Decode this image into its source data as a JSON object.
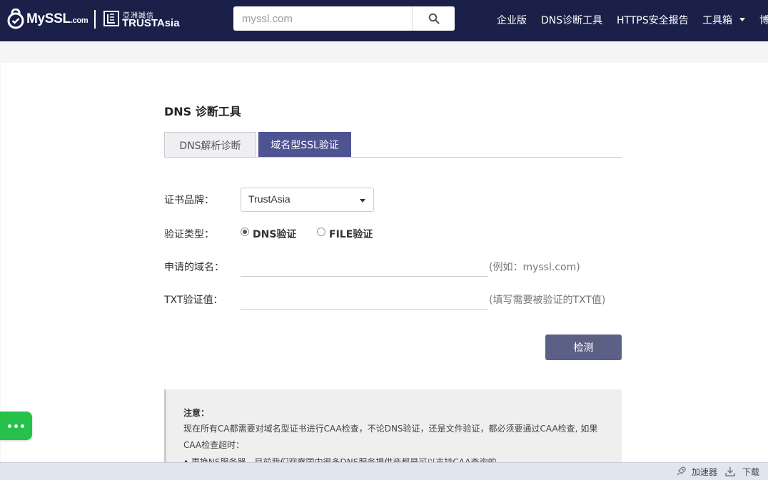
{
  "header": {
    "logo_myssl_main": "MySSL",
    "logo_myssl_suffix": ".com",
    "logo_trustasia_cn": "亞洲誠信",
    "logo_trustasia_en": "TRUSTAsia",
    "search_placeholder": "myssl.com",
    "nav": {
      "enterprise": "企业版",
      "dns_tool": "DNS诊断工具",
      "https_report": "HTTPS安全报告",
      "toolbox": "工具箱",
      "blog_partial": "博"
    },
    "bg_color": "#1b2049"
  },
  "page": {
    "title": "DNS 诊断工具",
    "tabs": [
      {
        "label": "DNS解析诊断",
        "active": false
      },
      {
        "label": "域名型SSL验证",
        "active": true
      }
    ],
    "form": {
      "brand_label": "证书品牌：",
      "brand_value": "TrustAsia",
      "type_label": "验证类型：",
      "type_options": [
        {
          "label": "DNS验证",
          "selected": true
        },
        {
          "label": "FILE验证",
          "selected": false
        }
      ],
      "domain_label": "申请的域名：",
      "domain_value": "",
      "domain_hint": "(例如：myssl.com)",
      "txt_label": "TXT验证值：",
      "txt_value": "",
      "txt_hint": "(填写需要被验证的TXT值)",
      "submit_label": "检测"
    },
    "notice": {
      "title": "注意：",
      "text": "现在所有CA都需要对域名型证书进行CAA检查，不论DNS验证，还是文件验证，都必须要通过CAA检查, 如果CAA检查超时：",
      "bullet": "• 更换NS服务器，目前我们观察国内很多DNS服务提供商都是可以支持CAA查询的"
    },
    "accent_color": "#4e5391",
    "button_color": "#5c6084"
  },
  "statusbar": {
    "accelerator": "加速器",
    "download": "下载"
  }
}
